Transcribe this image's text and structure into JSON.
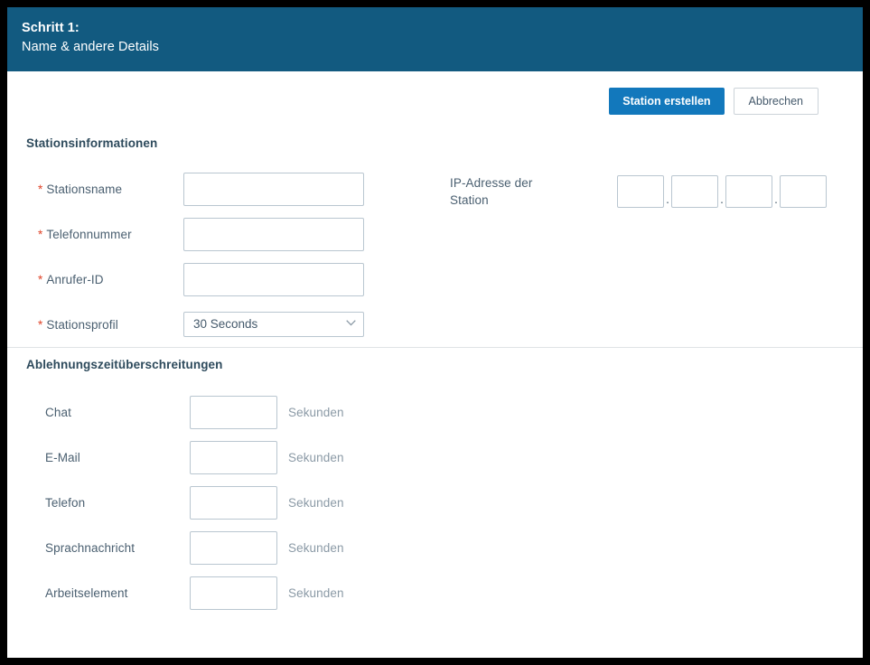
{
  "header": {
    "step_label": "Schritt 1:",
    "subtitle": "Name & andere Details",
    "background_color": "#125a80"
  },
  "actions": {
    "primary_label": "Station erstellen",
    "secondary_label": "Abbrechen",
    "primary_color": "#1278bc"
  },
  "sections": [
    {
      "id": "station-information",
      "title": "Stationsinformationen",
      "fields": [
        {
          "label": "Stationsname",
          "required": true,
          "value": "",
          "type": "text"
        },
        {
          "label": "Telefonnummer",
          "required": true,
          "value": "",
          "type": "text"
        },
        {
          "label": "Anrufer-ID",
          "required": true,
          "value": "",
          "type": "text"
        },
        {
          "label": "Stationsprofil",
          "required": true,
          "value": "30 Seconds",
          "type": "select"
        }
      ],
      "ip_field": {
        "label_line1": "IP-Adresse der",
        "label_line2": "Station",
        "separator": ".",
        "octets": [
          "",
          "",
          "",
          ""
        ]
      }
    },
    {
      "id": "rejection-timeouts",
      "title": "Ablehnungszeitüberschreitungen",
      "unit": "Sekunden",
      "rows": [
        {
          "label": "Chat",
          "value": ""
        },
        {
          "label": "E-Mail",
          "value": ""
        },
        {
          "label": "Telefon",
          "value": ""
        },
        {
          "label": "Sprachnachricht",
          "value": ""
        },
        {
          "label": "Arbeitselement",
          "value": ""
        }
      ]
    }
  ],
  "icons": {
    "chevron_down": "chevron-down-icon"
  },
  "required_marker": "*",
  "colors": {
    "required_asterisk": "#e0452a",
    "label_text": "#4a5f70",
    "input_border": "#b9c6d0",
    "unit_text": "#8b9aa6",
    "divider": "#dfe3e6"
  }
}
